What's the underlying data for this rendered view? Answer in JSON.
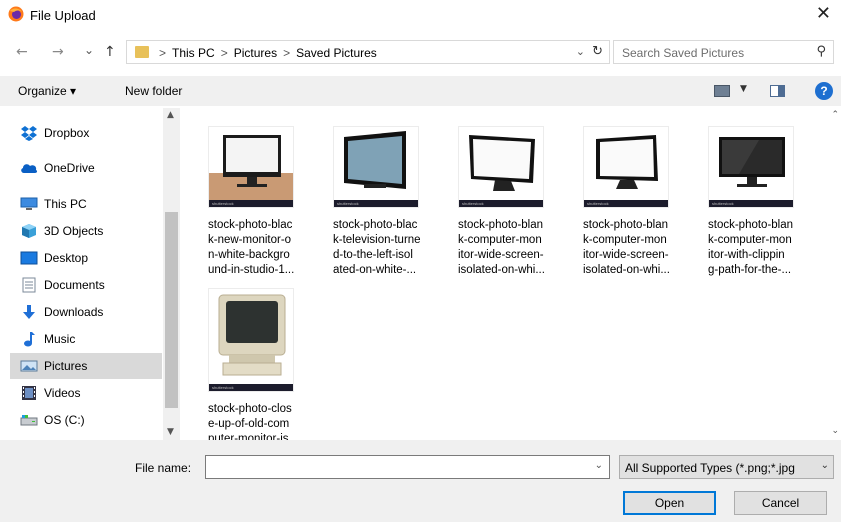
{
  "window": {
    "title": "File Upload",
    "close_glyph": "✕"
  },
  "navigation": {
    "back_glyph": "←",
    "forward_glyph": "→",
    "recent_glyph": "⌄",
    "up_glyph": "↑",
    "breadcrumb": [
      "This PC",
      "Pictures",
      "Saved Pictures"
    ],
    "breadcrumb_separator": ">",
    "search_placeholder": "Search Saved Pictures"
  },
  "toolbar": {
    "organize_label": "Organize ▾",
    "new_folder_label": "New folder",
    "help_glyph": "?"
  },
  "nav_pane": {
    "items": [
      {
        "label": "Dropbox",
        "icon": "dropbox-icon"
      },
      {
        "label": "OneDrive",
        "icon": "cloud-icon"
      },
      {
        "label": "This PC",
        "icon": "computer-icon"
      },
      {
        "label": "3D Objects",
        "icon": "cube-icon"
      },
      {
        "label": "Desktop",
        "icon": "desktop-icon"
      },
      {
        "label": "Documents",
        "icon": "document-icon"
      },
      {
        "label": "Downloads",
        "icon": "download-icon"
      },
      {
        "label": "Music",
        "icon": "music-note-icon"
      },
      {
        "label": "Pictures",
        "icon": "pictures-icon",
        "selected": true
      },
      {
        "label": "Videos",
        "icon": "video-icon"
      },
      {
        "label": "OS (C:)",
        "icon": "drive-icon"
      }
    ]
  },
  "files": [
    {
      "caption": [
        "stock-photo-blac",
        "k-new-monitor-o",
        "n-white-backgro",
        "und-in-studio-1..."
      ]
    },
    {
      "caption": [
        "stock-photo-blac",
        "k-television-turne",
        "d-to-the-left-isol",
        "ated-on-white-..."
      ]
    },
    {
      "caption": [
        "stock-photo-blan",
        "k-computer-mon",
        "itor-wide-screen-",
        "isolated-on-whi..."
      ]
    },
    {
      "caption": [
        "stock-photo-blan",
        "k-computer-mon",
        "itor-wide-screen-",
        "isolated-on-whi..."
      ]
    },
    {
      "caption": [
        "stock-photo-blan",
        "k-computer-mon",
        "itor-with-clippin",
        "g-path-for-the-..."
      ]
    },
    {
      "caption": [
        "stock-photo-clos",
        "e-up-of-old-com",
        "puter-monitor-is"
      ]
    }
  ],
  "bottom": {
    "file_name_label": "File name:",
    "file_name_value": "",
    "file_type_value": "All Supported Types (*.png;*.jpg",
    "open_label": "Open",
    "cancel_label": "Cancel"
  },
  "colors": {
    "accent": "#0078d7",
    "selected_bg": "#d9d9d9",
    "toolbar_bg": "#f0f0f0"
  }
}
